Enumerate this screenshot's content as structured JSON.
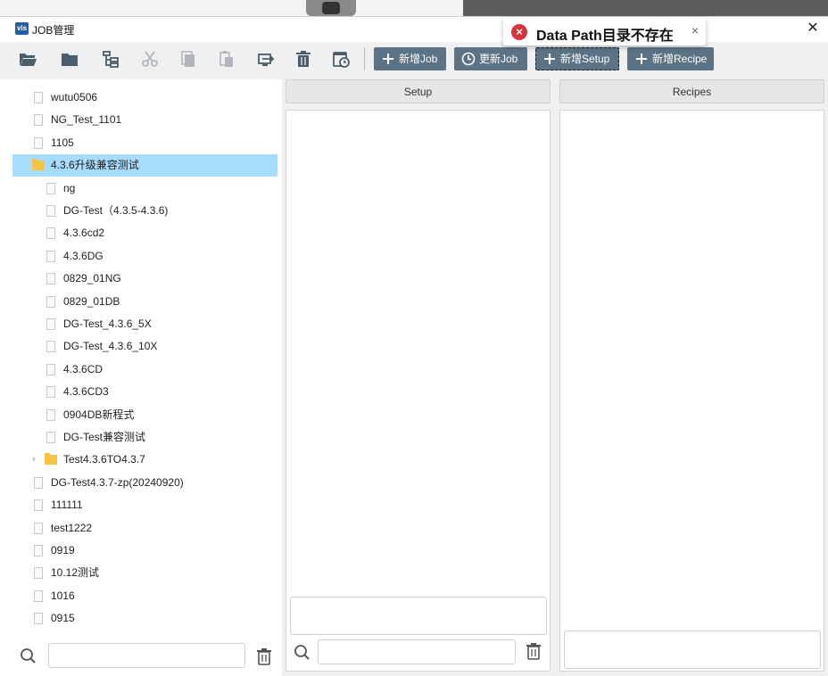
{
  "window": {
    "title": "JOB管理",
    "app_icon_text": "vis"
  },
  "toast": {
    "message": "Data Path目录不存在",
    "icon": "error-icon",
    "close": "×"
  },
  "toolbar": {
    "icons": [
      "open-folder-icon",
      "folder-icon",
      "tree-structure-icon",
      "cut-icon",
      "copy-icon",
      "paste-icon",
      "import-icon",
      "delete-icon",
      "schedule-icon"
    ],
    "buttons": [
      {
        "label": "新增Job",
        "icon": "plus-icon"
      },
      {
        "label": "更新Job",
        "icon": "clock-icon"
      },
      {
        "label": "新增Setup",
        "icon": "plus-icon"
      },
      {
        "label": "新增Recipe",
        "icon": "plus-icon"
      }
    ]
  },
  "tree": {
    "items": [
      {
        "label": "wutu0506",
        "type": "file",
        "level": 0
      },
      {
        "label": "NG_Test_1101",
        "type": "file",
        "level": 0
      },
      {
        "label": "1105",
        "type": "file",
        "level": 0
      },
      {
        "label": "4.3.6升级兼容测试",
        "type": "folder",
        "level": 0,
        "selected": true,
        "expanded": true
      },
      {
        "label": "ng",
        "type": "file",
        "level": 1
      },
      {
        "label": "DG-Test（4.3.5-4.3.6)",
        "type": "file",
        "level": 1
      },
      {
        "label": "4.3.6cd2",
        "type": "file",
        "level": 1
      },
      {
        "label": "4.3.6DG",
        "type": "file",
        "level": 1
      },
      {
        "label": "0829_01NG",
        "type": "file",
        "level": 1
      },
      {
        "label": "0829_01DB",
        "type": "file",
        "level": 1
      },
      {
        "label": "DG-Test_4.3.6_5X",
        "type": "file",
        "level": 1
      },
      {
        "label": "DG-Test_4.3.6_10X",
        "type": "file",
        "level": 1
      },
      {
        "label": "4.3.6CD",
        "type": "file",
        "level": 1
      },
      {
        "label": "4.3.6CD3",
        "type": "file",
        "level": 1
      },
      {
        "label": "0904DB新程式",
        "type": "file",
        "level": 1
      },
      {
        "label": "DG-Test兼容测试",
        "type": "file",
        "level": 1
      },
      {
        "label": "Test4.3.6TO4.3.7",
        "type": "folder",
        "level": 1,
        "collapsed": true
      },
      {
        "label": "DG-Test4.3.7-zp(20240920)",
        "type": "file",
        "level": 0
      },
      {
        "label": "111111",
        "type": "file",
        "level": 0
      },
      {
        "label": "test1222",
        "type": "file",
        "level": 0
      },
      {
        "label": "0919",
        "type": "file",
        "level": 0
      },
      {
        "label": "10.12测试",
        "type": "file",
        "level": 0
      },
      {
        "label": "1016",
        "type": "file",
        "level": 0
      },
      {
        "label": "0915",
        "type": "file",
        "level": 0
      }
    ],
    "search_value": ""
  },
  "setup_panel": {
    "header": "Setup",
    "search_value": ""
  },
  "recipes_panel": {
    "header": "Recipes"
  },
  "colors": {
    "button_bg": "#5b7384",
    "selected_row": "#a8dcff",
    "error_red": "#d9343a",
    "folder": "#f6c343"
  }
}
